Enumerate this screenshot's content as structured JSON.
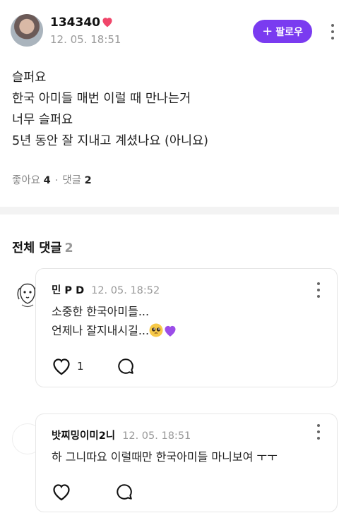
{
  "post": {
    "author": "134340",
    "time": "12. 05. 18:51",
    "follow_label": "팔로우",
    "lines": [
      "슬퍼요",
      "한국 아미들 매번 이럴 때 만나는거",
      "너무 슬퍼요",
      "5년 동안 잘 지내고 계셨나요 (아니요)"
    ],
    "likes_label": "좋아요",
    "likes_count": "4",
    "comments_label": "댓글",
    "comments_count": "2"
  },
  "comments_section": {
    "title": "전체 댓글",
    "count": "2"
  },
  "comments": [
    {
      "author": "민 P D",
      "time": "12. 05. 18:52",
      "lines": [
        "소중한 한국아미들...",
        "언제나 잘지내시길..."
      ],
      "emojis": [
        "pleading-face-emoji",
        "purple-heart-emoji"
      ],
      "like_count": "1"
    },
    {
      "author": "밧찌밍이미2니",
      "time": "12. 05. 18:51",
      "lines": [
        "하 그니따요 이럴때만 한국아미들 마니보여 ㅜㅜ"
      ],
      "like_count": ""
    }
  ],
  "colors": {
    "accent": "#7a3bf0",
    "heart": "#f0466a",
    "purple_heart": "#9b4de8"
  }
}
